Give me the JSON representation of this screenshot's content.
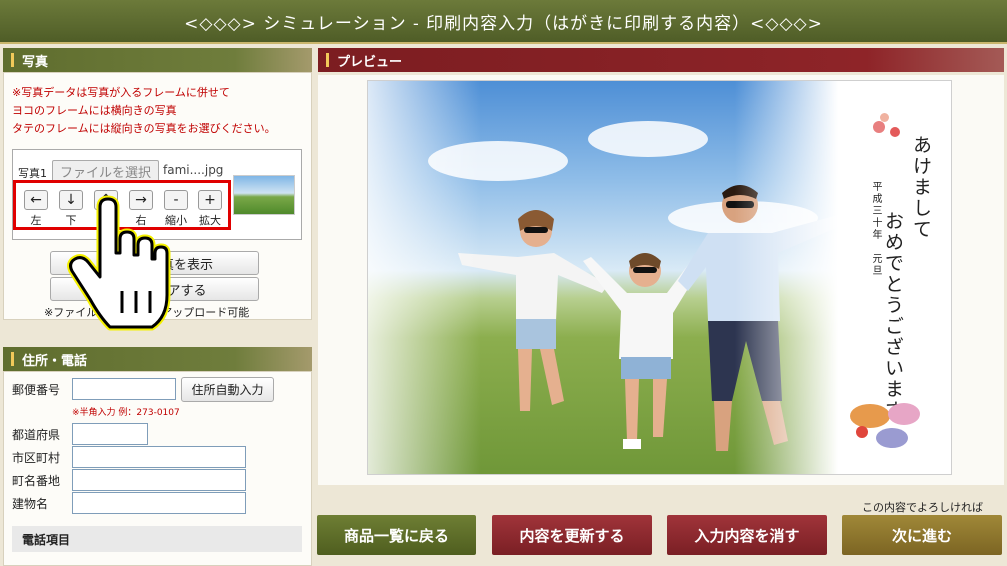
{
  "title": "<◇◇◇> シミュレーション - 印刷内容入力（はがきに印刷する内容）<◇◇◇>",
  "photo_panel": {
    "header": "写真",
    "notes": [
      "※写真データは写真が入るフレームに併せて",
      "ヨコのフレームには横向きの写真",
      "タテのフレームには縦向きの写真をお選びください。"
    ],
    "photo_label": "写真1",
    "file_button": "ファイルを選択",
    "file_name": "fami....jpg",
    "controls": [
      {
        "glyph": "←",
        "label": "左"
      },
      {
        "glyph": "↓",
        "label": "下"
      },
      {
        "glyph": "↑",
        "label": "上"
      },
      {
        "glyph": "→",
        "label": "右"
      },
      {
        "glyph": "-",
        "label": "縮小"
      },
      {
        "glyph": "+",
        "label": "拡大"
      }
    ],
    "show_photo_button": "選択した写真を表示",
    "clear_button": "写真をクリアする",
    "upload_note": "※ファイルは10MBまでアップロード可能"
  },
  "address_panel": {
    "header": "住所・電話",
    "postal_label": "郵便番号",
    "auto_fill_button": "住所自動入力",
    "postal_hint": "※半角入力 例：273-0107",
    "prefecture_label": "都道府県",
    "city_label": "市区町村",
    "street_label": "町名番地",
    "building_label": "建物名",
    "phone_section": "電話項目"
  },
  "preview": {
    "header": "プレビュー",
    "greeting_line1": "あけまして",
    "greeting_line2": "おめでとうございます",
    "date_text": "平成三十年　元旦"
  },
  "buttons": {
    "back": "商品一覧に戻る",
    "update": "内容を更新する",
    "clear": "入力内容を消す",
    "next": "次に進む",
    "next_note": "この内容でよろしければ"
  },
  "colors": {
    "olive": "#5f6d2e",
    "red": "#7c1d21",
    "brown": "#7c6523",
    "note_red": "#c00000"
  }
}
